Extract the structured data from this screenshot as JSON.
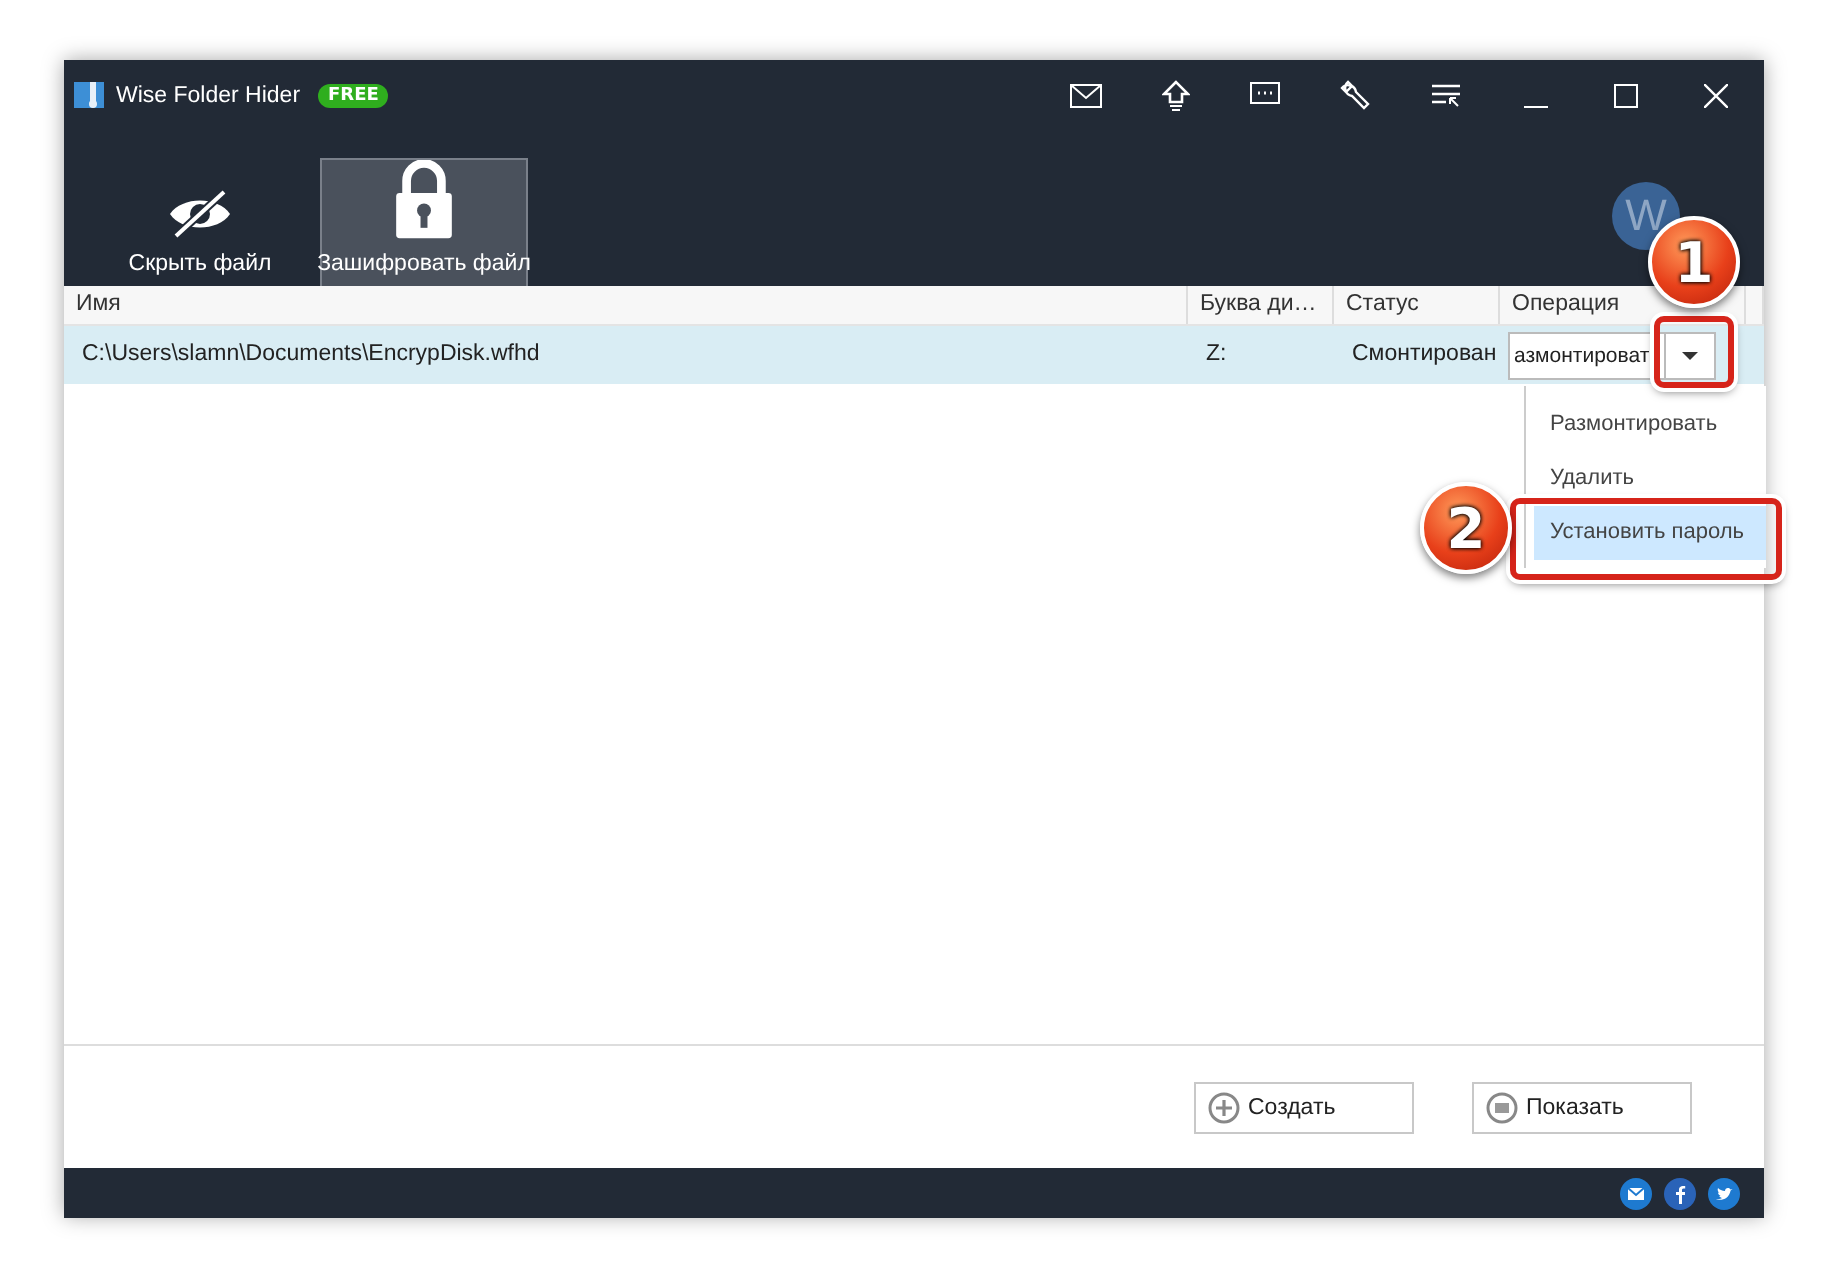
{
  "window": {
    "title": "Wise Folder Hider",
    "badge": "FREE"
  },
  "tabs": [
    {
      "label": "Скрыть файл",
      "selected": false,
      "kind": "hide"
    },
    {
      "label": "Зашифровать файл",
      "selected": true,
      "kind": "lock"
    }
  ],
  "avatar": {
    "letter": "W"
  },
  "table": {
    "columns": [
      "Имя",
      "Буква ди…",
      "Статус",
      "Операция"
    ],
    "rows": [
      {
        "cells": [
          "C:\\Users\\slamn\\Documents\\EncrypDisk.wfhd",
          "Z:",
          "Смонтирован"
        ],
        "operation": "азмонтироват",
        "selected": true
      }
    ]
  },
  "dropdown_menu": {
    "items": [
      {
        "label": "Размонтировать",
        "selected": false
      },
      {
        "label": "Удалить",
        "selected": false
      },
      {
        "label": "Установить пароль",
        "selected": true
      }
    ]
  },
  "buttons": [
    {
      "label": "Создать",
      "kind": "add"
    },
    {
      "label": "Показать",
      "kind": "show"
    }
  ],
  "callouts": [
    {
      "label": "1"
    },
    {
      "label": "2"
    }
  ]
}
